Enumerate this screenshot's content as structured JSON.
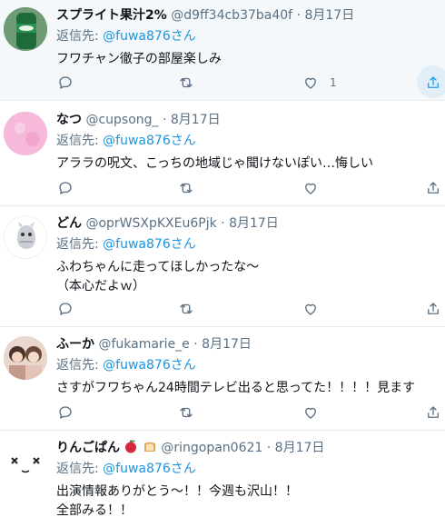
{
  "tweets": [
    {
      "name": "スプライト果汁2%",
      "handle": "@d9ff34cb37ba40f",
      "sep": "·",
      "date": "8月17日",
      "reply_prefix": "返信先:",
      "reply_to": "@fuwa876さん",
      "text": "フワチャン徹子の部屋楽しみ",
      "like_count": "1",
      "avatar_color": "#4a7a55"
    },
    {
      "name": "なつ",
      "handle": "@cupsong_",
      "sep": "·",
      "date": "8月17日",
      "reply_prefix": "返信先:",
      "reply_to": "@fuwa876さん",
      "text": "アララの呪文、こっちの地域じゃ聞けないぽい…悔しい",
      "avatar_color": "#f4b6d8"
    },
    {
      "name": "どん",
      "handle": "@oprWSXpKXEu6Pjk",
      "sep": "·",
      "date": "8月17日",
      "reply_prefix": "返信先:",
      "reply_to": "@fuwa876さん",
      "text_lines": [
        "ふわちゃんに走ってほしかったな～",
        "（本心だよｗ）"
      ],
      "avatar_color": "#ffffff"
    },
    {
      "name": "ふーか",
      "handle": "@fukamarie_e",
      "sep": "·",
      "date": "8月17日",
      "reply_prefix": "返信先:",
      "reply_to": "@fuwa876さん",
      "text": "さすがフワちゃん24時間テレビ出ると思ってた！！！！見ます",
      "avatar_color": "#d9b8a8"
    },
    {
      "name": "りんごぱん",
      "handle": "@ringopan0621",
      "sep": "·",
      "date": "8月17日",
      "reply_prefix": "返信先:",
      "reply_to": "@fuwa876さん",
      "text_lines": [
        "出演情報ありがとう～！！今週も沢山！！",
        "全部みる！！"
      ],
      "avatar_color": "#ffffff"
    }
  ],
  "icons": {
    "reply": "reply-icon",
    "retweet": "retweet-icon",
    "like": "heart-icon",
    "share": "share-icon",
    "name_emoji": [
      "apple-emoji",
      "bread-emoji"
    ]
  },
  "colors": {
    "link": "#1b95e0",
    "secondary_text": "#5b7083",
    "share_active": "#1da1f2",
    "hover_bg": "#f5f8fa"
  }
}
